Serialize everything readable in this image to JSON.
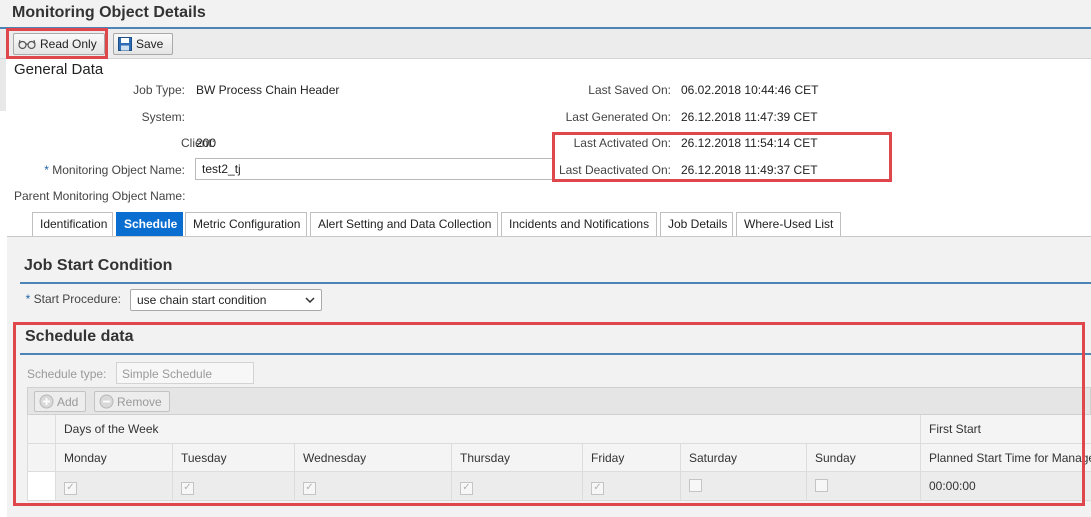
{
  "page_title": "Monitoring Object Details",
  "toolbar": {
    "read_only_label": "Read Only",
    "save_label": "Save"
  },
  "general": {
    "section_title": "General Data",
    "job_type_label": "Job Type:",
    "job_type_value": "BW Process Chain Header",
    "system_label": "System:",
    "system_value": "",
    "client_label": "Client:",
    "client_value": "200",
    "mo_name_label": "Monitoring Object Name:",
    "mo_name_required": "*",
    "mo_name_value": "test2_tj",
    "parent_label": "Parent Monitoring Object Name:",
    "last_saved_label": "Last Saved On:",
    "last_saved_value": "06.02.2018 10:44:46 CET",
    "last_generated_label": "Last Generated On:",
    "last_generated_value": "26.12.2018 11:47:39 CET",
    "last_activated_label": "Last Activated On:",
    "last_activated_value": "26.12.2018 11:54:14 CET",
    "last_deactivated_label": "Last Deactivated On:",
    "last_deactivated_value": "26.12.2018 11:49:37 CET"
  },
  "tabs": [
    {
      "label": "Identification",
      "active": false
    },
    {
      "label": "Schedule",
      "active": true
    },
    {
      "label": "Metric Configuration",
      "active": false
    },
    {
      "label": "Alert Setting and Data Collection",
      "active": false
    },
    {
      "label": "Incidents and Notifications",
      "active": false
    },
    {
      "label": "Job Details",
      "active": false
    },
    {
      "label": "Where-Used List",
      "active": false
    }
  ],
  "job_start": {
    "title": "Job Start Condition",
    "start_procedure_label": "Start Procedure:",
    "required": "*",
    "start_procedure_value": "use chain start condition"
  },
  "schedule": {
    "title": "Schedule data",
    "type_label": "Schedule type:",
    "type_value": "Simple Schedule",
    "add_label": "Add",
    "remove_label": "Remove",
    "group_days": "Days of the Week",
    "group_first_start": "First Start",
    "columns": [
      "Monday",
      "Tuesday",
      "Wednesday",
      "Thursday",
      "Friday",
      "Saturday",
      "Sunday",
      "Planned Start Time for Manage"
    ],
    "row": {
      "days_checked": [
        true,
        true,
        true,
        true,
        true,
        false,
        false
      ],
      "planned_start": "00:00:00"
    }
  },
  "colors": {
    "accent": "#0a6ed1",
    "section_line": "#4d84b6",
    "highlight": "#e0474c"
  }
}
